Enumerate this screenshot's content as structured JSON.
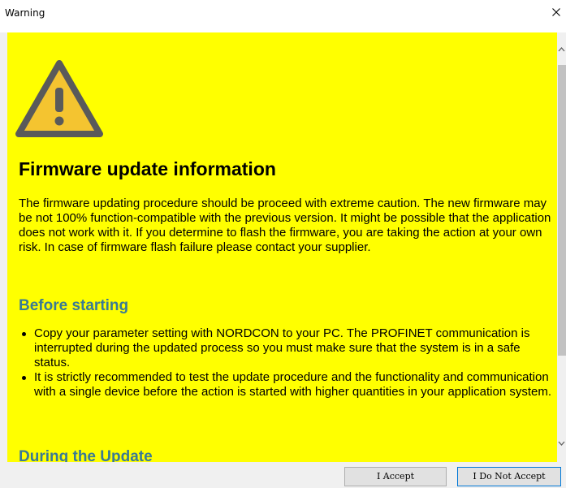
{
  "window": {
    "title": "Warning",
    "close_icon": "close-icon"
  },
  "content": {
    "background_color": "#ffff00",
    "warning_icon": "warning-triangle-icon",
    "heading": "Firmware update information",
    "intro": "The firmware updating procedure should be proceed with extreme caution. The new firmware may be not 100% function-compatible with the previous version. It might be possible that the application does not work with it. If you determine to flash the firmware, you are taking the action at your own risk. In case of firmware flash failure please contact your supplier.",
    "sections": [
      {
        "heading": "Before starting",
        "bullets": [
          "Copy your parameter setting with NORDCON to your PC. The PROFINET communication is interrupted during the updated process so you must make sure that the system is in a safe status.",
          "It is strictly recommended to test the update procedure and the functionality and communication with a single device before the action is started with higher quantities in your application system."
        ]
      },
      {
        "heading": "During the Update"
      }
    ],
    "section_heading_color": "#3a7a94"
  },
  "buttons": {
    "accept": "I Accept",
    "decline": "I Do Not Accept"
  },
  "scrollbar": {
    "up_icon": "chevron-up-icon",
    "down_icon": "chevron-down-icon"
  }
}
